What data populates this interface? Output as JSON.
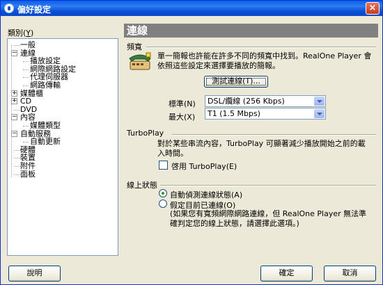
{
  "window": {
    "title": "偏好設定",
    "close_label": "×"
  },
  "sidebar": {
    "category_label": "類別(",
    "category_key": "Y",
    "category_suffix": ")",
    "tree": [
      {
        "label": "一般",
        "level": 0,
        "expander": ""
      },
      {
        "label": "連線",
        "level": 0,
        "expander": "−"
      },
      {
        "label": "播放設定",
        "level": 1,
        "expander": ""
      },
      {
        "label": "網際網路設定",
        "level": 1,
        "expander": ""
      },
      {
        "label": "代理伺服器",
        "level": 1,
        "expander": ""
      },
      {
        "label": "網路傳輸",
        "level": 1,
        "expander": ""
      },
      {
        "label": "媒體櫃",
        "level": 0,
        "expander": "+"
      },
      {
        "label": "CD",
        "level": 0,
        "expander": "+"
      },
      {
        "label": "DVD",
        "level": 0,
        "expander": ""
      },
      {
        "label": "內容",
        "level": 0,
        "expander": "−"
      },
      {
        "label": "媒體類型",
        "level": 1,
        "expander": ""
      },
      {
        "label": "自動服務",
        "level": 0,
        "expander": "−"
      },
      {
        "label": "自動更新",
        "level": 1,
        "expander": ""
      },
      {
        "label": "硬體",
        "level": 0,
        "expander": ""
      },
      {
        "label": "裝置",
        "level": 0,
        "expander": ""
      },
      {
        "label": "附件",
        "level": 0,
        "expander": ""
      },
      {
        "label": "面板",
        "level": 0,
        "expander": ""
      }
    ]
  },
  "main": {
    "header": "連線",
    "bandwidth": {
      "title": "頻寬",
      "description": "單一簡報也許能在許多不同的頻寬中找到。RealOne Player 會依照這些設定來選擇要播放的簡報。",
      "test_button": "測試連線(T)...",
      "normal_label": "標準(N)",
      "normal_value": "DSL/纜線 (256 Kbps)",
      "max_label": "最大(X)",
      "max_value": "T1 (1.5 Mbps)"
    },
    "turboplay": {
      "title": "TurboPlay",
      "description": "對於某些串流內容，TurboPlay 可顯著減少播放開始之前的載入時間。",
      "checkbox_label": "啓用 TurboPlay(E)",
      "checked": false
    },
    "online_status": {
      "title": "線上狀態",
      "option_auto": "自動偵測連線狀態(A)",
      "option_manual": "假定目前已連線(O)",
      "note": "(如果您有寬頻網際網路連線，但 RealOne Player 無法準確判定您的線上狀態，請選擇此選項。)",
      "selected": "auto"
    }
  },
  "footer": {
    "help_label": "說明",
    "ok_label": "確定",
    "cancel_label": "取消"
  }
}
